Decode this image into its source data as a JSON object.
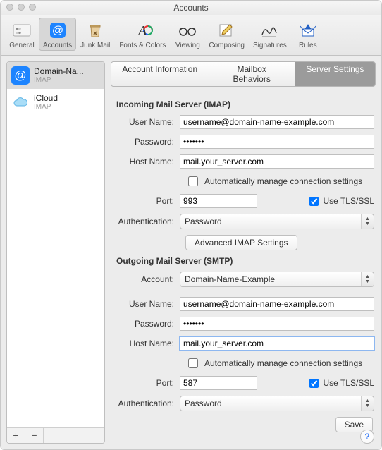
{
  "window": {
    "title": "Accounts"
  },
  "toolbar": {
    "general": "General",
    "accounts": "Accounts",
    "junk": "Junk Mail",
    "fonts": "Fonts & Colors",
    "viewing": "Viewing",
    "composing": "Composing",
    "signatures": "Signatures",
    "rules": "Rules"
  },
  "sidebar": {
    "accounts_list": [
      {
        "name": "Domain-Na...",
        "protocol": "IMAP"
      },
      {
        "name": "iCloud",
        "protocol": "IMAP"
      }
    ],
    "selected_index": 0,
    "add_label": "+",
    "remove_label": "−"
  },
  "tabs": {
    "info": "Account Information",
    "mailbox": "Mailbox Behaviors",
    "server": "Server Settings",
    "active": "server"
  },
  "incoming": {
    "heading": "Incoming Mail Server (IMAP)",
    "labels": {
      "username": "User Name:",
      "password": "Password:",
      "hostname": "Host Name:",
      "port": "Port:",
      "auth": "Authentication:"
    },
    "username": "username@domain-name-example.com",
    "password": "•••••••",
    "hostname": "mail.your_server.com",
    "auto_manage": "Automatically manage connection settings",
    "auto_manage_checked": false,
    "port": "993",
    "use_tls": "Use TLS/SSL",
    "use_tls_checked": true,
    "auth": "Password",
    "advanced_btn": "Advanced IMAP Settings"
  },
  "outgoing": {
    "heading": "Outgoing Mail Server (SMTP)",
    "labels": {
      "account": "Account:",
      "username": "User Name:",
      "password": "Password:",
      "hostname": "Host Name:",
      "port": "Port:",
      "auth": "Authentication:"
    },
    "account": "Domain-Name-Example",
    "username": "username@domain-name-example.com",
    "password": "•••••••",
    "hostname": "mail.your_server.com",
    "auto_manage": "Automatically manage connection settings",
    "auto_manage_checked": false,
    "port": "587",
    "use_tls": "Use TLS/SSL",
    "use_tls_checked": true,
    "auth": "Password"
  },
  "actions": {
    "save": "Save",
    "help": "?"
  }
}
